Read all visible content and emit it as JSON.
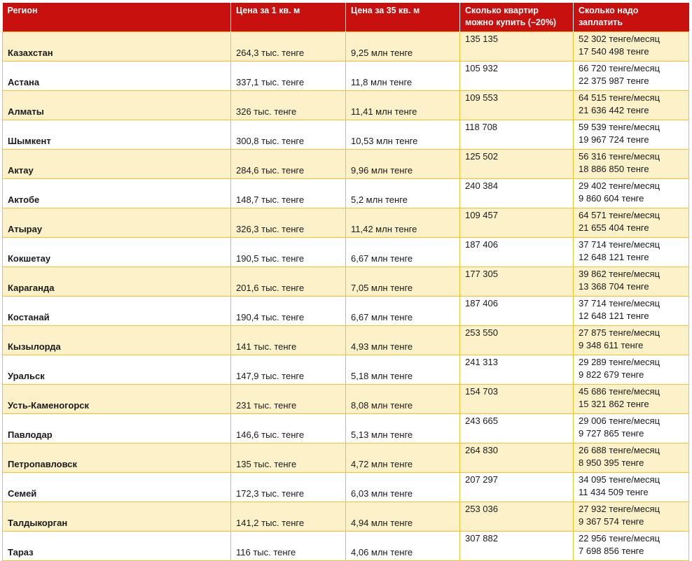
{
  "table": {
    "headers": {
      "region": "Регион",
      "price_per_sqm": "Цена за 1 кв. м",
      "price_35_sqm": "Цена за 35 кв. м",
      "apartments_count_line1": "Сколько квартир",
      "apartments_count_line2": "можно купить (–20%)",
      "payment_line1": "Сколько надо",
      "payment_line2": "заплатить"
    },
    "rows": [
      {
        "region": "Казахстан",
        "price1": "264,3 тыс. тенге",
        "price35": "9,25 млн тенге",
        "count": "135 135",
        "monthly": "52 302 тенге/месяц",
        "total": "17 540 498 тенге"
      },
      {
        "region": "Астана",
        "price1": "337,1 тыс. тенге",
        "price35": "11,8 млн тенге",
        "count": "105 932",
        "monthly": "66 720 тенге/месяц",
        "total": "22 375 987 тенге"
      },
      {
        "region": "Алматы",
        "price1": "326 тыс. тенге",
        "price35": "11,41 млн тенге",
        "count": "109 553",
        "monthly": "64 515 тенге/месяц",
        "total": "21 636 442 тенге"
      },
      {
        "region": "Шымкент",
        "price1": "300,8 тыс. тенге",
        "price35": "10,53 млн тенге",
        "count": "118 708",
        "monthly": "59 539 тенге/месяц",
        "total": "19 967 724 тенге"
      },
      {
        "region": "Актау",
        "price1": "284,6 тыс. тенге",
        "price35": "9,96 млн тенге",
        "count": "125 502",
        "monthly": "56 316 тенге/месяц",
        "total": "18 886 850 тенге"
      },
      {
        "region": "Актобе",
        "price1": "148,7 тыс. тенге",
        "price35": "5,2 млн тенге",
        "count": "240 384",
        "monthly": "29 402 тенге/месяц",
        "total": "9 860 604 тенге"
      },
      {
        "region": "Атырау",
        "price1": "326,3 тыс. тенге",
        "price35": "11,42 млн тенге",
        "count": "109 457",
        "monthly": "64 571 тенге/месяц",
        "total": "21 655 404 тенге"
      },
      {
        "region": "Кокшетау",
        "price1": "190,5 тыс. тенге",
        "price35": "6,67 млн тенге",
        "count": "187 406",
        "monthly": "37 714 тенге/месяц",
        "total": "12 648 121 тенге"
      },
      {
        "region": "Караганда",
        "price1": "201,6 тыс. тенге",
        "price35": "7,05 млн тенге",
        "count": "177 305",
        "monthly": "39 862 тенге/месяц",
        "total": "13 368 704 тенге"
      },
      {
        "region": "Костанай",
        "price1": "190,4 тыс. тенге",
        "price35": "6,67 млн тенге",
        "count": "187 406",
        "monthly": "37 714 тенге/месяц",
        "total": "12 648 121 тенге"
      },
      {
        "region": "Кызылорда",
        "price1": "141 тыс. тенге",
        "price35": "4,93 млн тенге",
        "count": "253 550",
        "monthly": "27 875 тенге/месяц",
        "total": "9 348 611 тенге"
      },
      {
        "region": "Уральск",
        "price1": "147,9 тыс. тенге",
        "price35": "5,18 млн тенге",
        "count": "241 313",
        "monthly": "29 289 тенге/месяц",
        "total": "9 822 679 тенге"
      },
      {
        "region": "Усть-Каменогорск",
        "price1": "231 тыс. тенге",
        "price35": "8,08 млн тенге",
        "count": "154 703",
        "monthly": "45 686 тенге/месяц",
        "total": "15 321 862 тенге"
      },
      {
        "region": "Павлодар",
        "price1": "146,6 тыс. тенге",
        "price35": "5,13 млн тенге",
        "count": "243 665",
        "monthly": "29 006 тенге/месяц",
        "total": "9 727 865 тенге"
      },
      {
        "region": "Петропавловск",
        "price1": "135 тыс. тенге",
        "price35": "4,72 млн тенге",
        "count": "264 830",
        "monthly": "26 688 тенге/месяц",
        "total": "8 950 395 тенге"
      },
      {
        "region": "Семей",
        "price1": "172,3 тыс. тенге",
        "price35": "6,03 млн тенге",
        "count": "207 297",
        "monthly": "34 095 тенге/месяц",
        "total": "11 434 509 тенге"
      },
      {
        "region": "Талдыкорган",
        "price1": "141,2 тыс. тенге",
        "price35": "4,94 млн тенге",
        "count": "253 036",
        "monthly": "27 932 тенге/месяц",
        "total": "9 367 574 тенге"
      },
      {
        "region": "Тараз",
        "price1": "116 тыс. тенге",
        "price35": "4,06 млн тенге",
        "count": "307 882",
        "monthly": "22 956 тенге/месяц",
        "total": "7 698 856 тенге"
      }
    ]
  },
  "colors": {
    "header_bg": "#c8100e",
    "header_text": "#ffffff",
    "stripe_bg": "#fdf1c9",
    "border": "#f0c230"
  }
}
